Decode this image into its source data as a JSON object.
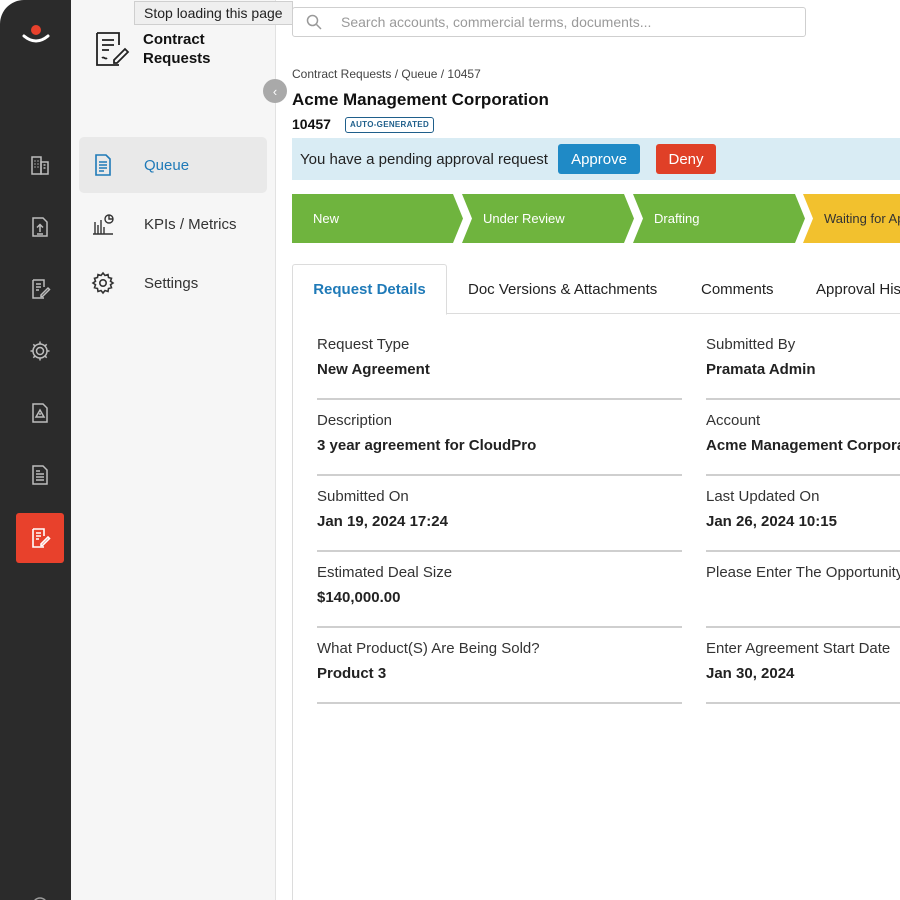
{
  "tooltip": "Stop loading this page",
  "rail": {
    "items": [
      {
        "icon": "building-icon"
      },
      {
        "icon": "upload-icon"
      },
      {
        "icon": "contract-edit-icon"
      },
      {
        "icon": "settings-cog-icon"
      },
      {
        "icon": "warning-document-icon"
      },
      {
        "icon": "report-document-icon"
      },
      {
        "icon": "contract-requests-icon",
        "active": true
      }
    ]
  },
  "subnav": {
    "title": "Contract\nRequests",
    "items": [
      {
        "label": "Queue",
        "icon": "queue-document-icon",
        "active": true
      },
      {
        "label": "KPIs / Metrics",
        "icon": "metrics-chart-icon"
      },
      {
        "label": "Settings",
        "icon": "gear-icon"
      }
    ]
  },
  "search": {
    "placeholder": "Search accounts, commercial terms, documents..."
  },
  "breadcrumb": "Contract Requests / Queue / 10457",
  "request": {
    "title": "Acme Management Corporation",
    "id": "10457",
    "badge": "AUTO-GENERATED"
  },
  "approval": {
    "message": "You have a pending approval request",
    "approve_label": "Approve",
    "deny_label": "Deny"
  },
  "stages": [
    {
      "label": "New",
      "state": "done"
    },
    {
      "label": "Under Review",
      "state": "done"
    },
    {
      "label": "Drafting",
      "state": "done"
    },
    {
      "label": "Waiting for Approval",
      "state": "current"
    }
  ],
  "tabs": [
    "Request Details",
    "Doc Versions & Attachments",
    "Comments",
    "Approval History"
  ],
  "fields_left": [
    {
      "label": "Request Type",
      "value": "New Agreement"
    },
    {
      "label": "Description",
      "value": "3 year agreement for CloudPro"
    },
    {
      "label": "Submitted On",
      "value": "Jan 19, 2024 17:24"
    },
    {
      "label": "Estimated Deal Size",
      "value": "$140,000.00"
    },
    {
      "label": "What Product(S) Are Being Sold?",
      "value": "Product 3"
    }
  ],
  "fields_right": [
    {
      "label": "Submitted By",
      "value": "Pramata Admin"
    },
    {
      "label": "Account",
      "value": "Acme Management Corporation"
    },
    {
      "label": "Last Updated On",
      "value": "Jan 26, 2024 10:15"
    },
    {
      "label": "Please Enter The Opportunity ID",
      "value": ""
    },
    {
      "label": "Enter Agreement Start Date",
      "value": "Jan 30, 2024"
    }
  ],
  "colors": {
    "rail_bg": "#2b2b2b",
    "accent_red": "#e8412c",
    "link_blue": "#1f7ab8",
    "approve_blue": "#1f8ac6",
    "deny_red": "#e04027",
    "stage_done": "#6fb43e",
    "stage_current": "#f2c12e",
    "banner_bg": "#d9ecf4"
  }
}
